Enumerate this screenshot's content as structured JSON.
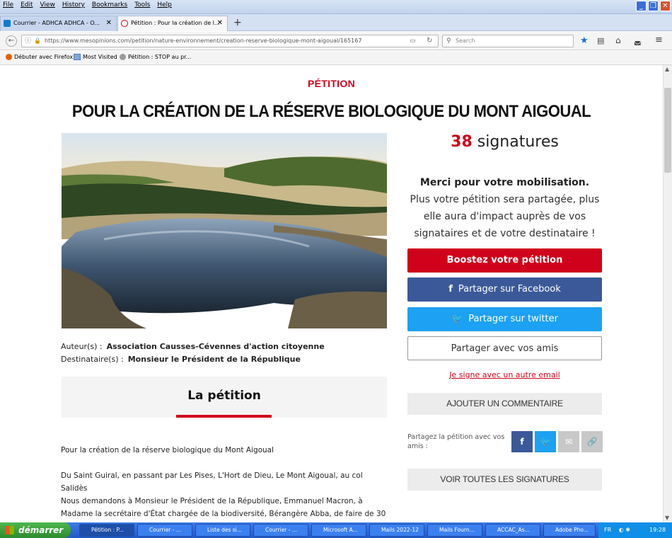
{
  "browser": {
    "menu": [
      "File",
      "Edit",
      "View",
      "History",
      "Bookmarks",
      "Tools",
      "Help"
    ],
    "tabs": [
      {
        "label": "Courrier - ADHCA ADHCA - O..."
      },
      {
        "label": "Pétition : Pour la création de l..."
      }
    ],
    "url": "https://www.mesopinions.com/petition/nature-environnement/creation-reserve-biologique-mont-aigoual/165167",
    "search_placeholder": "Search",
    "bookmarks": [
      "Débuter avec Firefox",
      "Most Visited",
      "Pétition : STOP au pr..."
    ]
  },
  "page": {
    "kicker": "PÉTITION",
    "title": "POUR LA CRÉATION DE LA RÉSERVE BIOLOGIQUE DU MONT AIGOUAL",
    "signature_count": "38",
    "signature_label": "signatures",
    "thanks_bold": "Merci pour votre mobilisation.",
    "thanks_text": "Plus votre pétition sera partagée, plus elle aura d'impact auprès de vos signataires et de votre destinataire !",
    "author_label": "Auteur(s) :",
    "author": "Association Causses-Cévennes d'action citoyenne",
    "recipient_label": "Destinataire(s) :",
    "recipient": "Monsieur le Président de la République",
    "petition_heading": "La pétition",
    "body": [
      "Pour la création de la réserve biologique du Mont Aigoual",
      "Du Saint Guiral, en passant par Les Pises, L'Hort de Dieu, Le Mont Aigoual, au col Salidès",
      "Nous demandons à Monsieur le Président de la République, Emmanuel Macron, à Madame la secrétaire d'État chargée de la biodiversité, Bérangère Abba, de faire de 30"
    ],
    "buttons": {
      "boost": "Boostez votre pétition",
      "facebook": "Partager sur Facebook",
      "twitter": "Partager sur twitter",
      "friends": "Partager avec vos amis",
      "other_email": "Je signe avec un autre email",
      "comment": "AJOUTER UN COMMENTAIRE",
      "all_signatures": "VOIR TOUTES LES SIGNATURES"
    },
    "share_label": "Partagez la pétition avec vos amis :"
  },
  "taskbar": {
    "start": "démarrer",
    "items": [
      "Pétition : P...",
      "Courrier - ...",
      "Liste des si...",
      "Courrier - ...",
      "Microsoft A...",
      "Mails 2022-12",
      "Mails Fourn...",
      "ACCAC_As...",
      "Adobe Pho..."
    ],
    "lang": "FR",
    "clock": "19:28"
  },
  "colors": {
    "accent": "#d0021b",
    "facebook": "#3b5998",
    "twitter": "#1da1f2"
  }
}
